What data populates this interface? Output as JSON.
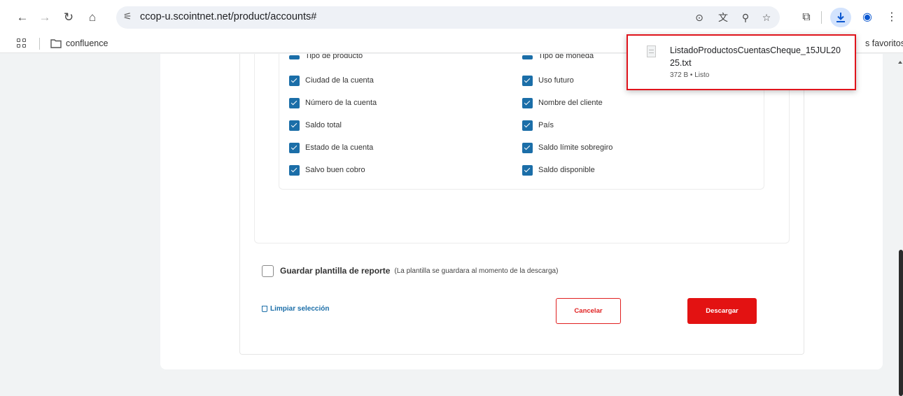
{
  "browser": {
    "url": "ccop-u.scointnet.net/product/accounts#",
    "icons": {
      "back": "arrow-left-icon",
      "forward": "arrow-right-icon",
      "reload": "reload-icon",
      "home": "home-icon",
      "site_info": "tune-icon",
      "location": "location-pin-icon",
      "translate": "translate-icon",
      "zoom": "zoom-icon",
      "bookmark": "star-icon",
      "extensions": "puzzle-icon",
      "downloads": "download-icon",
      "profile": "profile-icon",
      "menu": "kebab-menu-icon"
    }
  },
  "bookmarks_bar": {
    "folder_label": "confluence",
    "right_label": "s favoritos"
  },
  "fields": {
    "left": [
      {
        "label": "Tipo de producto",
        "checked": true
      },
      {
        "label": "Ciudad de la cuenta",
        "checked": true
      },
      {
        "label": "Número de la cuenta",
        "checked": true
      },
      {
        "label": "Saldo total",
        "checked": true
      },
      {
        "label": "Estado de la cuenta",
        "checked": true
      },
      {
        "label": "Salvo buen cobro",
        "checked": true
      }
    ],
    "right": [
      {
        "label": "Tipo de moneda",
        "checked": true
      },
      {
        "label": "Uso futuro",
        "checked": true
      },
      {
        "label": "Nombre del cliente",
        "checked": true
      },
      {
        "label": "País",
        "checked": true
      },
      {
        "label": "Saldo límite sobregiro",
        "checked": true
      },
      {
        "label": "Saldo disponible",
        "checked": true
      }
    ]
  },
  "template": {
    "title": "Guardar plantilla de reporte",
    "hint": "(La plantilla se guardara al momento de la descarga)",
    "checked": false
  },
  "actions": {
    "clear": "Limpiar selección",
    "cancel": "Cancelar",
    "download": "Descargar"
  },
  "download_panel": {
    "filename": "ListadoProductosCuentasCheque_15JUL2025.txt",
    "status": "372 B • Listo"
  },
  "colors": {
    "accent_blue": "#1b6ea8",
    "brand_red": "#e31212",
    "highlight_red": "#e0141c"
  }
}
